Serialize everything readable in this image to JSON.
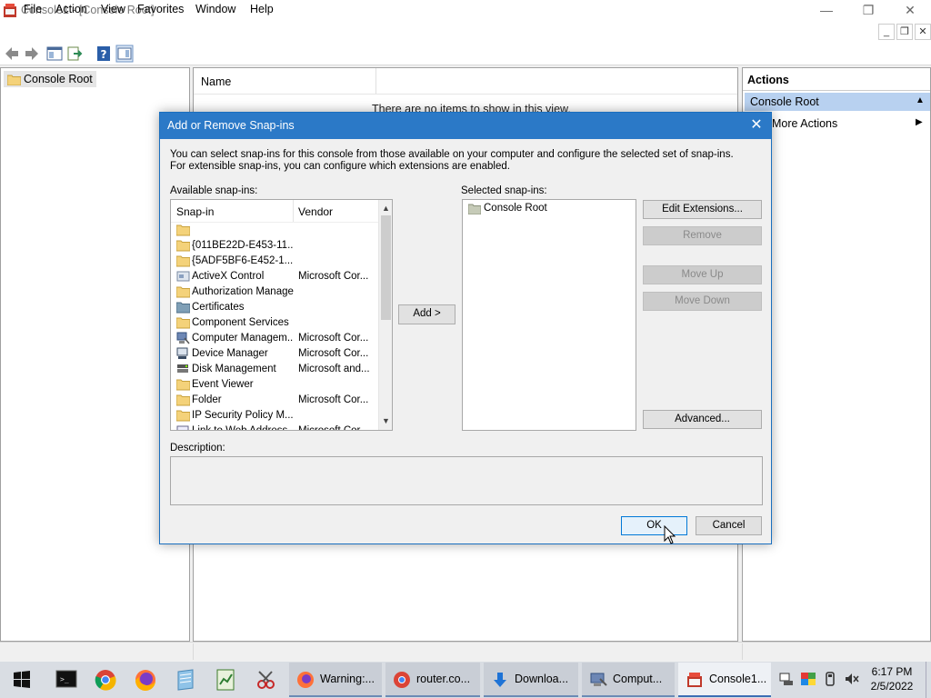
{
  "window": {
    "title": "Console1 - [Console Root]",
    "min_glyph": "—",
    "max_glyph": "❐",
    "close_glyph": "✕"
  },
  "menu": {
    "items": [
      "File",
      "Action",
      "View",
      "Favorites",
      "Window",
      "Help"
    ],
    "mdi_min": "_",
    "mdi_restore": "❐",
    "mdi_close": "✕"
  },
  "toolbar": {
    "icons": [
      "back-arrow-icon",
      "forward-arrow-icon",
      "show-hide-tree-icon",
      "export-list-icon",
      "help-icon",
      "show-hide-action-pane-icon"
    ]
  },
  "tree": {
    "root_label": "Console Root"
  },
  "results": {
    "column_name": "Name",
    "empty_message": "There are no items to show in this view."
  },
  "actions": {
    "title": "Actions",
    "section": "Console Root",
    "more_actions": "More Actions",
    "collapse_glyph": "▲",
    "expand_glyph": "▶"
  },
  "dialog": {
    "title": "Add or Remove Snap-ins",
    "close_glyph": "✕",
    "description": "You can select snap-ins for this console from those available on your computer and configure the selected set of snap-ins. For extensible snap-ins, you can configure which extensions are enabled.",
    "available_label": "Available snap-ins:",
    "selected_label": "Selected snap-ins:",
    "description_label": "Description:",
    "columns": {
      "snapin": "Snap-in",
      "vendor": "Vendor"
    },
    "available": [
      {
        "name": "",
        "vendor": "",
        "icon": "folder-icon"
      },
      {
        "name": "{011BE22D-E453-11...",
        "vendor": "",
        "icon": "folder-icon"
      },
      {
        "name": "{5ADF5BF6-E452-1...",
        "vendor": "",
        "icon": "folder-icon"
      },
      {
        "name": "ActiveX Control",
        "vendor": "Microsoft Cor...",
        "icon": "activex-icon"
      },
      {
        "name": "Authorization Manager",
        "vendor": "",
        "icon": "folder-icon"
      },
      {
        "name": "Certificates",
        "vendor": "",
        "icon": "certificates-icon"
      },
      {
        "name": "Component Services",
        "vendor": "",
        "icon": "folder-icon"
      },
      {
        "name": "Computer Managem...",
        "vendor": "Microsoft Cor...",
        "icon": "computer-management-icon"
      },
      {
        "name": "Device Manager",
        "vendor": "Microsoft Cor...",
        "icon": "device-manager-icon"
      },
      {
        "name": "Disk Management",
        "vendor": "Microsoft and...",
        "icon": "disk-management-icon"
      },
      {
        "name": "Event Viewer",
        "vendor": "",
        "icon": "folder-icon"
      },
      {
        "name": "Folder",
        "vendor": "Microsoft Cor...",
        "icon": "folder-icon"
      },
      {
        "name": "IP Security Policy M...",
        "vendor": "",
        "icon": "folder-icon"
      },
      {
        "name": "Link to Web Address",
        "vendor": "Microsoft Cor...",
        "icon": "link-icon"
      }
    ],
    "scroll_up_glyph": "▲",
    "scroll_down_glyph": "▼",
    "add_label": "Add >",
    "selected_items": [
      "Console Root"
    ],
    "buttons": {
      "edit_extensions": "Edit Extensions...",
      "remove": "Remove",
      "move_up": "Move Up",
      "move_down": "Move Down",
      "advanced": "Advanced...",
      "ok": "OK",
      "cancel": "Cancel"
    }
  },
  "taskbar": {
    "pinned": [
      "command-prompt-icon",
      "chrome-icon",
      "firefox-icon",
      "notepad-icon",
      "spreadsheet-icon",
      "snipping-tool-icon"
    ],
    "tasks": [
      {
        "label": "Warning:...",
        "icon": "firefox-icon"
      },
      {
        "label": "router.co...",
        "icon": "chrome-icon"
      },
      {
        "label": "Downloa...",
        "icon": "download-icon"
      },
      {
        "label": "Comput...",
        "icon": "computer-management-icon"
      },
      {
        "label": "Console1...",
        "icon": "mmc-icon",
        "active": true
      }
    ],
    "time": "6:17 PM",
    "date": "2/5/2022"
  },
  "colors": {
    "dialog_title": "#2b79c7",
    "accent": "#0078d7",
    "actions_header": "#b8d1f0"
  }
}
